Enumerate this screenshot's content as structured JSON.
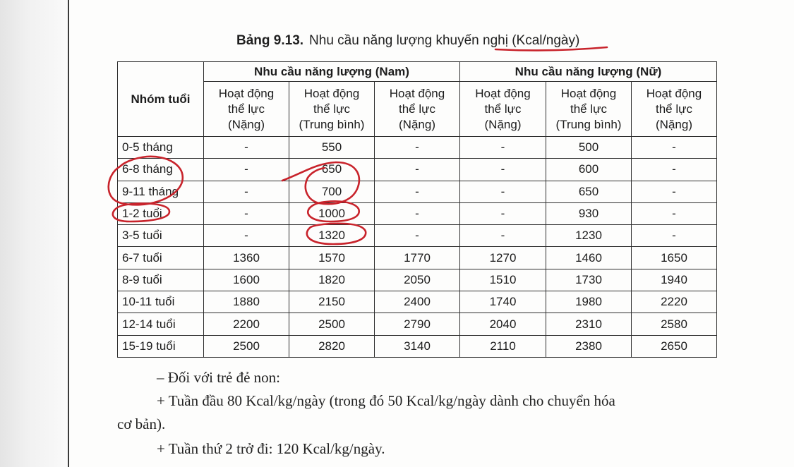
{
  "caption": {
    "number": "Bảng 9.13.",
    "title": "Nhu cầu năng lượng khuyến nghị (Kcal/ngày)"
  },
  "table": {
    "age_header": "Nhóm tuổi",
    "group_male": "Nhu cầu năng lượng (Nam)",
    "group_female": "Nhu cầu năng lượng (Nữ)",
    "sub_headers": [
      [
        "Hoạt động",
        "thể lực",
        "(Nặng)"
      ],
      [
        "Hoạt động",
        "thể lực",
        "(Trung bình)"
      ],
      [
        "Hoạt động",
        "thể lực",
        "(Nặng)"
      ],
      [
        "Hoạt động",
        "thể lực",
        "(Nặng)"
      ],
      [
        "Hoạt động",
        "thể lực",
        "(Trung bình)"
      ],
      [
        "Hoạt động",
        "thể lực",
        "(Nặng)"
      ]
    ],
    "rows": [
      [
        "0-5 tháng",
        "-",
        "550",
        "-",
        "-",
        "500",
        "-"
      ],
      [
        "6-8 tháng",
        "-",
        "650",
        "-",
        "-",
        "600",
        "-"
      ],
      [
        "9-11 tháng",
        "-",
        "700",
        "-",
        "-",
        "650",
        "-"
      ],
      [
        "1-2 tuổi",
        "-",
        "1000",
        "-",
        "-",
        "930",
        "-"
      ],
      [
        "3-5 tuổi",
        "-",
        "1320",
        "-",
        "-",
        "1230",
        "-"
      ],
      [
        "6-7 tuổi",
        "1360",
        "1570",
        "1770",
        "1270",
        "1460",
        "1650"
      ],
      [
        "8-9 tuổi",
        "1600",
        "1820",
        "2050",
        "1510",
        "1730",
        "1940"
      ],
      [
        "10-11 tuổi",
        "1880",
        "2150",
        "2400",
        "1740",
        "1980",
        "2220"
      ],
      [
        "12-14 tuổi",
        "2200",
        "2500",
        "2790",
        "2040",
        "2310",
        "2580"
      ],
      [
        "15-19 tuổi",
        "2500",
        "2820",
        "3140",
        "2110",
        "2380",
        "2650"
      ]
    ]
  },
  "notes": [
    "–  Đối với trẻ đẻ non:",
    "+  Tuần đầu 80 Kcal/kg/ngày (trong đó 50 Kcal/kg/ngày dành cho chuyển hóa",
    "cơ bản).",
    "+  Tuần thứ 2 trở đi: 120 Kcal/kg/ngày."
  ],
  "colors": {
    "annotation": "#c8232b",
    "ink": "#1c1c1c",
    "page": "#fdfdfc"
  }
}
